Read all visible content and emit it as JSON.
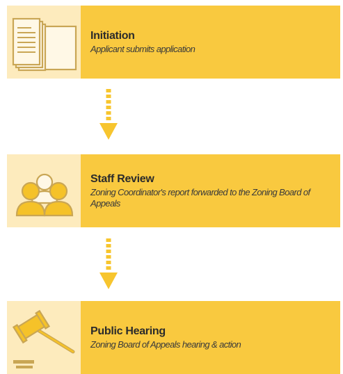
{
  "colors": {
    "icon_bg": "#fdebbd",
    "text_bg": "#f9c93f",
    "icon_fill": "#f5c229",
    "icon_stroke": "#c9a655",
    "arrow": "#f7c52e"
  },
  "steps": [
    {
      "icon": "document-stack-icon",
      "title": "Initiation",
      "description": "Applicant submits application"
    },
    {
      "icon": "people-group-icon",
      "title": "Staff Review",
      "description": "Zoning Coordinator's report forwarded to the Zoning Board of Appeals"
    },
    {
      "icon": "gavel-icon",
      "title": "Public Hearing",
      "description": "Zoning Board of Appeals hearing & action"
    }
  ]
}
